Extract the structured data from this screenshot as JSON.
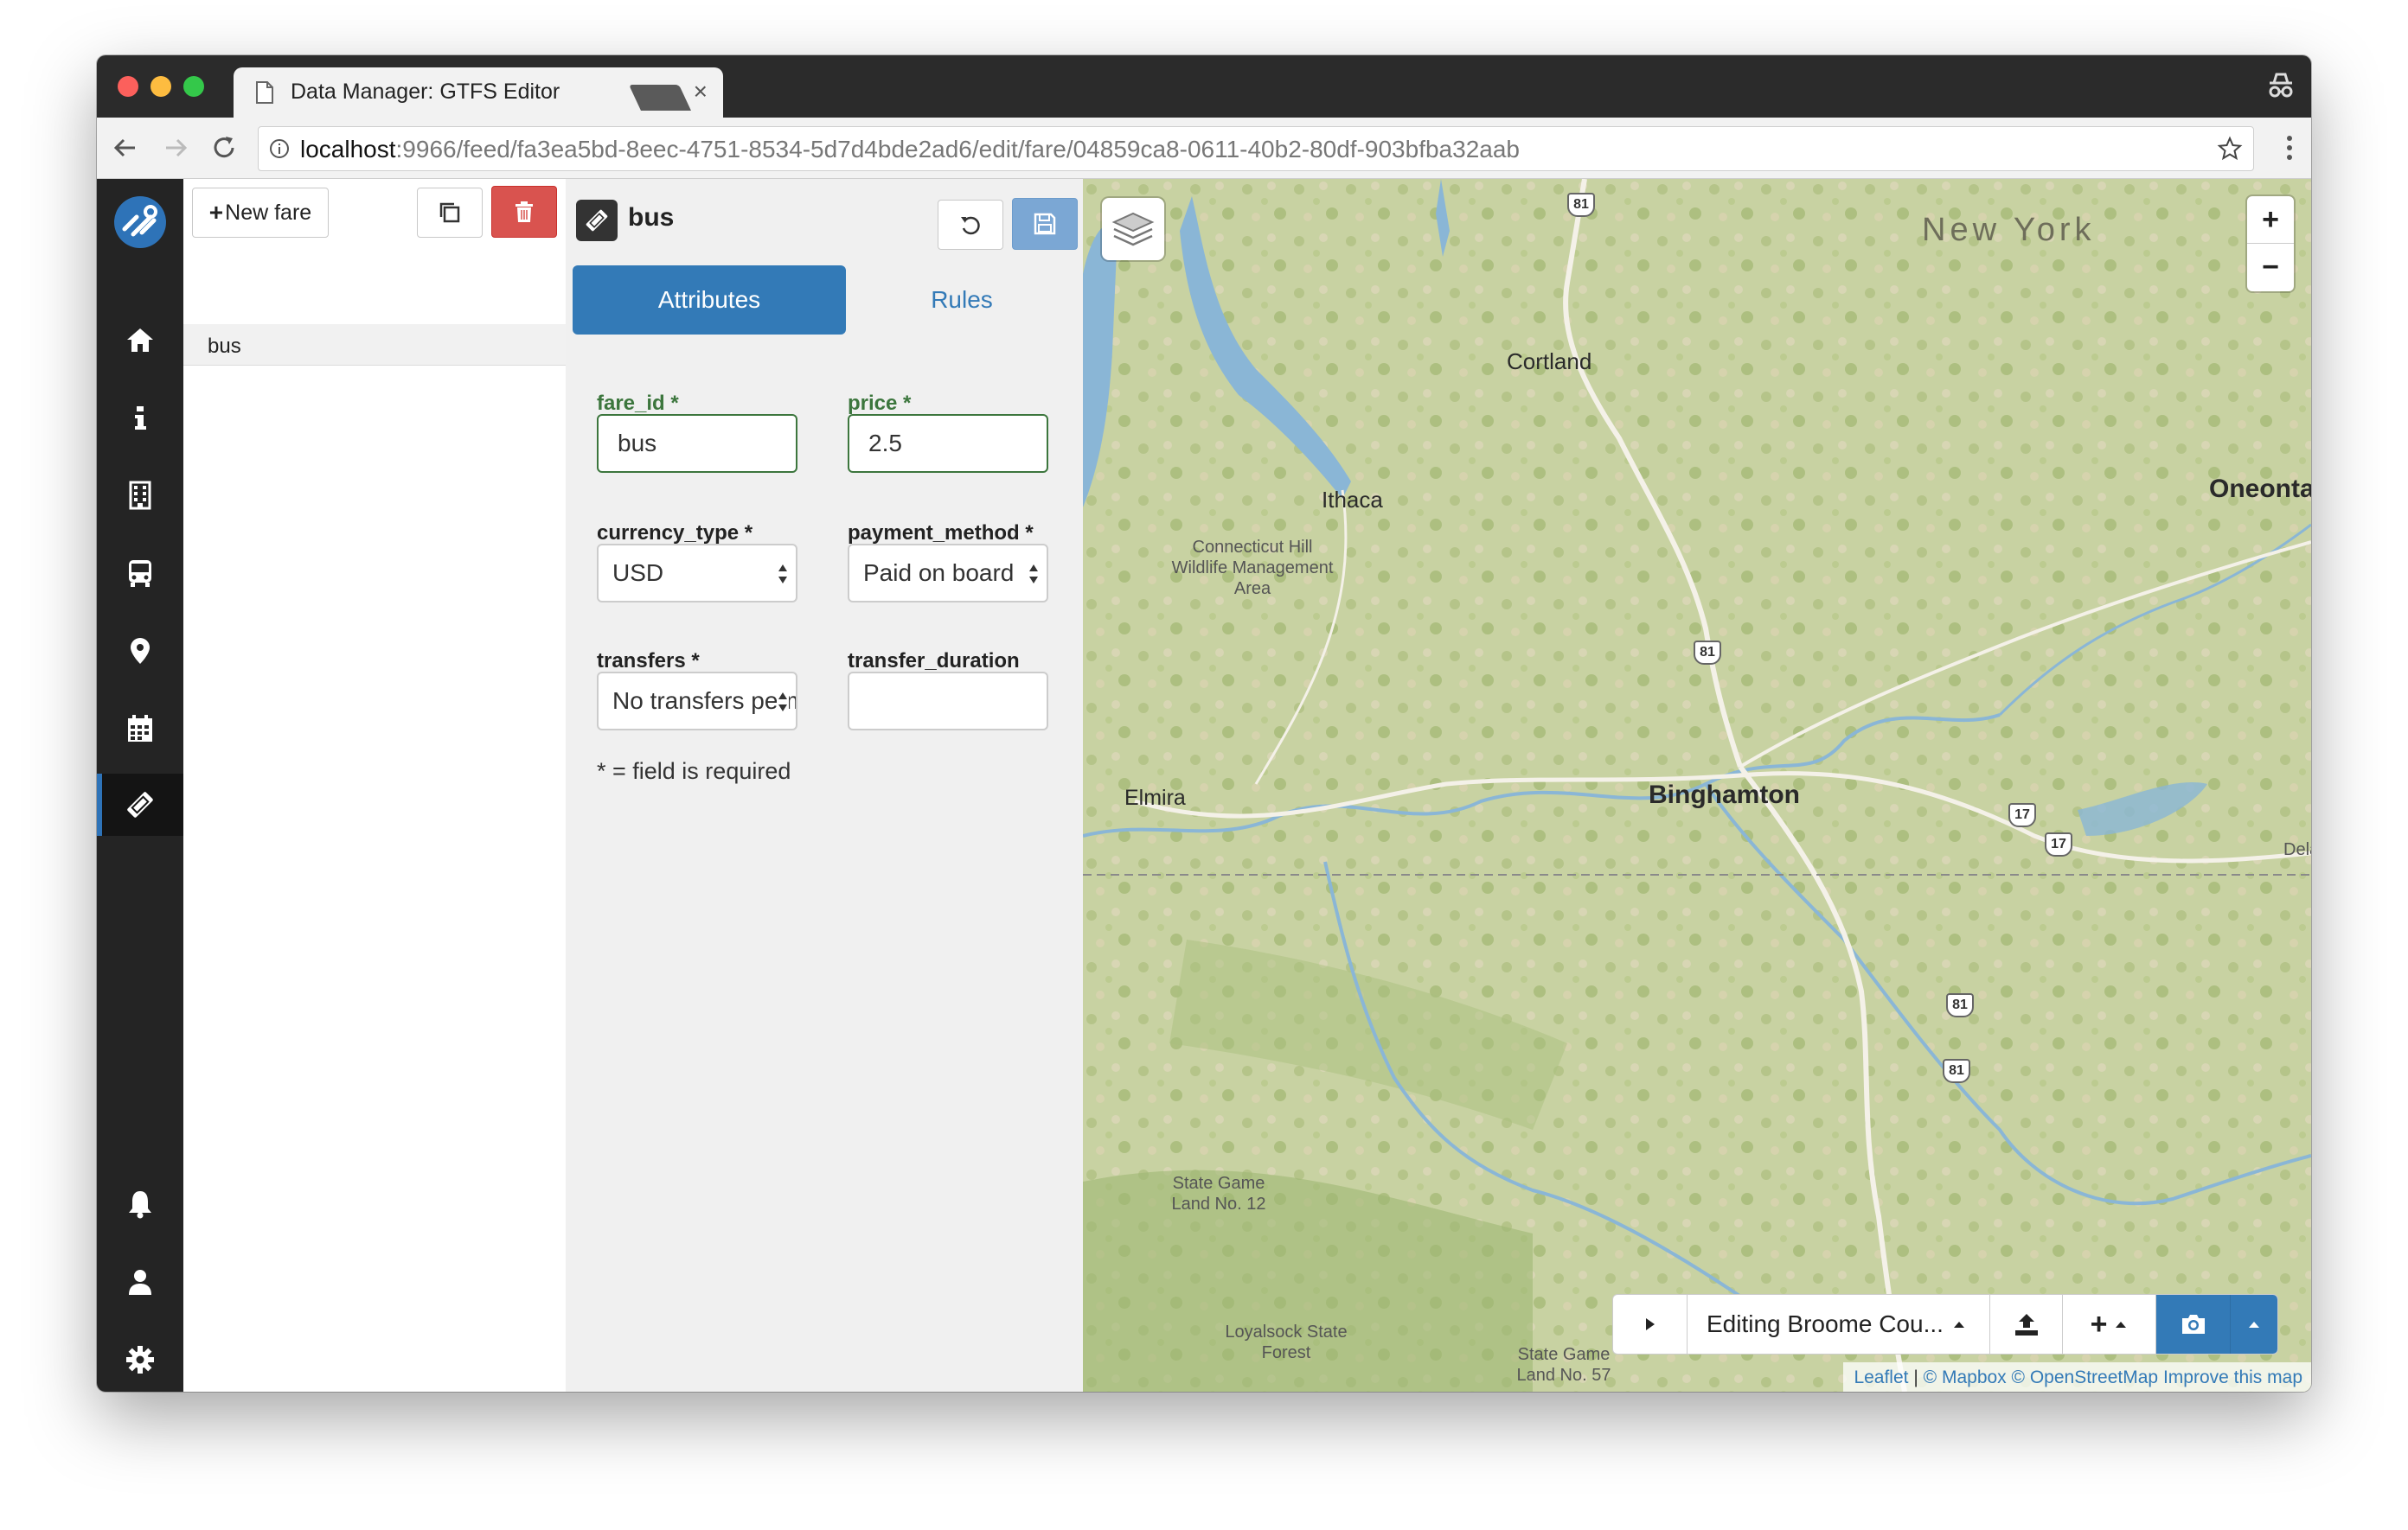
{
  "browser": {
    "tab_title": "Data Manager: GTFS Editor",
    "tab_close": "×",
    "url_host": "localhost",
    "url_rest": ":9966/feed/fa3ea5bd-8eec-4751-8534-5d7d4bde2ad6/edit/fare/04859ca8-0611-40b2-80df-903bfba32aab"
  },
  "sidebar": {
    "items": [
      {
        "icon": "home-icon"
      },
      {
        "icon": "info-icon"
      },
      {
        "icon": "building-icon"
      },
      {
        "icon": "bus-icon"
      },
      {
        "icon": "map-marker-icon"
      },
      {
        "icon": "calendar-icon"
      },
      {
        "icon": "ticket-icon",
        "active": true
      }
    ],
    "bottom_items": [
      {
        "icon": "bell-icon"
      },
      {
        "icon": "user-icon"
      },
      {
        "icon": "gear-icon"
      }
    ]
  },
  "list": {
    "new_button": "New fare",
    "items": [
      {
        "label": "bus",
        "selected": true
      }
    ]
  },
  "editor": {
    "title": "bus",
    "tabs": [
      {
        "label": "Attributes",
        "active": true
      },
      {
        "label": "Rules",
        "active": false
      }
    ],
    "fields": {
      "fare_id": {
        "label": "fare_id *",
        "value": "bus"
      },
      "price": {
        "label": "price *",
        "value": "2.5"
      },
      "currency_type": {
        "label": "currency_type *",
        "value": "USD"
      },
      "payment_method": {
        "label": "payment_method *",
        "value": "Paid on board"
      },
      "transfers": {
        "label": "transfers *",
        "value": "No transfers permitted"
      },
      "transfer_duration": {
        "label": "transfer_duration",
        "value": ""
      }
    },
    "required_note": "* = field is required"
  },
  "map": {
    "labels": {
      "new_york": "New York",
      "cortland": "Cortland",
      "ithaca": "Ithaca",
      "oneonta": "Oneonta",
      "binghamton": "Binghamton",
      "elmira": "Elmira",
      "connecticut_hill": "Connecticut Hill Wildlife Management Area",
      "state_game_12": "State Game Land No. 12",
      "loyalsock": "Loyalsock State Forest",
      "state_game_57": "State Game Land No. 57",
      "delaware": "Dela"
    },
    "shields": [
      "81",
      "81",
      "17",
      "17",
      "81",
      "81"
    ],
    "zoom_in": "+",
    "zoom_out": "−",
    "toolbar": {
      "editing_label": "Editing Broome Cou..."
    },
    "attribution": {
      "leaflet": "Leaflet",
      "sep": "|",
      "mapbox": "© Mapbox",
      "osm": "© OpenStreetMap",
      "improve": "Improve this map"
    }
  },
  "colors": {
    "primary": "#337ab7",
    "danger": "#d9534f",
    "success": "#3c763d",
    "sidebar": "#242424"
  }
}
